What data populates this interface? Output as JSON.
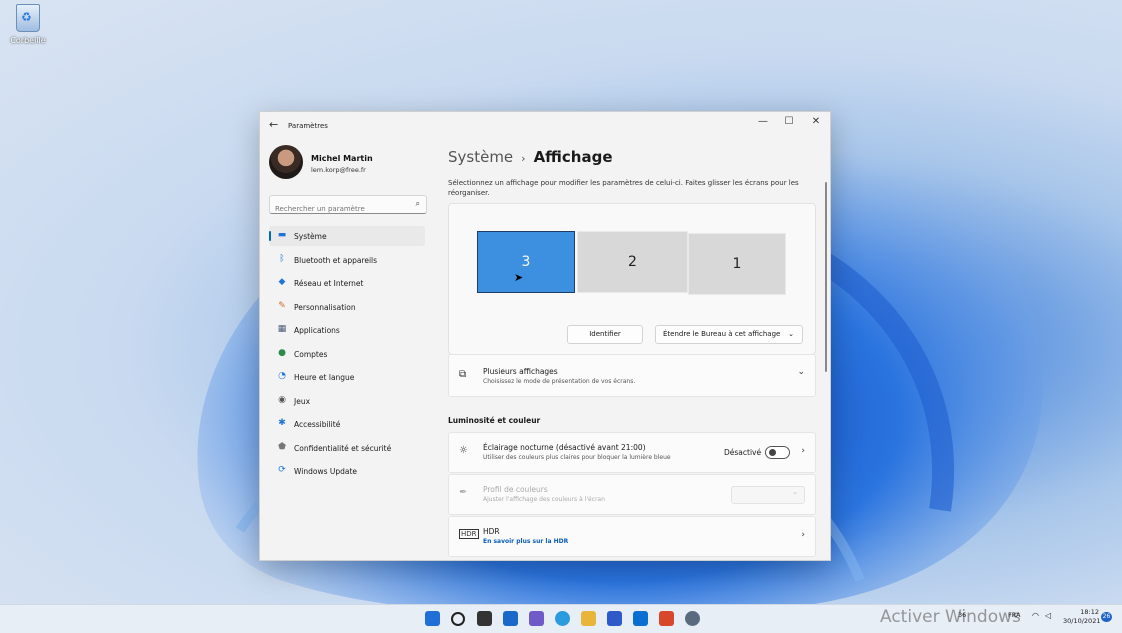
{
  "desktop": {
    "recycle_bin_label": "Corbeille"
  },
  "window": {
    "app_title": "Paramètres",
    "back_icon": "arrow-left-icon",
    "controls": [
      "—",
      "☐",
      "✕"
    ]
  },
  "user": {
    "name": "Michel Martin",
    "email": "lem.korp@free.fr"
  },
  "search": {
    "placeholder": "Rechercher un paramètre"
  },
  "nav": [
    {
      "label": "Système",
      "icon": "monitor-icon",
      "active": true
    },
    {
      "label": "Bluetooth et appareils",
      "icon": "bluetooth-icon"
    },
    {
      "label": "Réseau et Internet",
      "icon": "wifi-icon"
    },
    {
      "label": "Personnalisation",
      "icon": "brush-icon"
    },
    {
      "label": "Applications",
      "icon": "apps-icon"
    },
    {
      "label": "Comptes",
      "icon": "person-icon"
    },
    {
      "label": "Heure et langue",
      "icon": "globe-clock-icon"
    },
    {
      "label": "Jeux",
      "icon": "gamepad-icon"
    },
    {
      "label": "Accessibilité",
      "icon": "accessibility-icon"
    },
    {
      "label": "Confidentialité et sécurité",
      "icon": "shield-icon"
    },
    {
      "label": "Windows Update",
      "icon": "update-icon"
    }
  ],
  "breadcrumb": {
    "parent": "Système",
    "separator": "›",
    "current": "Affichage"
  },
  "intro_text": "Sélectionnez un affichage pour modifier les paramètres de celui-ci. Faites glisser les écrans pour les réorganiser.",
  "monitors": [
    {
      "label": "3",
      "selected": true
    },
    {
      "label": "2",
      "selected": false
    },
    {
      "label": "1",
      "selected": false
    }
  ],
  "identify_button": "Identifier",
  "display_mode_select": "Étendre le Bureau à cet affichage",
  "multiple_displays": {
    "title": "Plusieurs affichages",
    "subtitle": "Choisissez le mode de présentation de vos écrans."
  },
  "section_brightness": "Luminosité et couleur",
  "night_light": {
    "title": "Éclairage nocturne (désactivé avant 21:00)",
    "subtitle": "Utiliser des couleurs plus claires pour bloquer la lumière bleue",
    "state_label": "Désactivé",
    "enabled": false
  },
  "color_profile": {
    "title": "Profil de couleurs",
    "subtitle": "Ajuster l'affichage des couleurs à l'écran"
  },
  "hdr": {
    "title": "HDR",
    "link": "En savoir plus sur la HDR"
  },
  "taskbar": {
    "icons": [
      "windows-start-icon",
      "search-icon",
      "file-explorer-icon",
      "widgets-icon",
      "chat-icon",
      "edge-icon",
      "folder-icon",
      "store-icon",
      "mail-icon",
      "office-icon",
      "settings-icon"
    ],
    "watermark": "Activer Windows",
    "tray_temp": "36",
    "tray_lang": "FRA",
    "time": "18:12",
    "date": "30/10/2021",
    "notifications": "26"
  }
}
